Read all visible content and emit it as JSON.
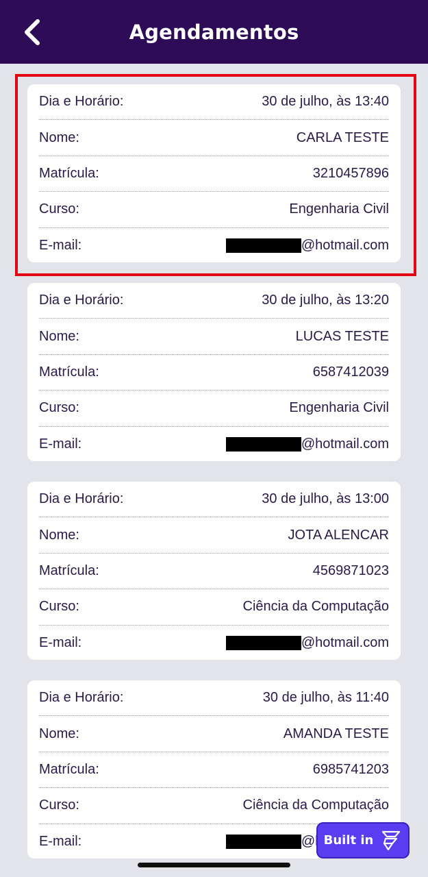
{
  "header": {
    "title": "Agendamentos"
  },
  "icons": {
    "back": "chevron-left-icon",
    "builtin": "flutterflow-logo-icon"
  },
  "labels": {
    "datetime": "Dia e Horário:",
    "name": "Nome:",
    "enrollment": "Matrícula:",
    "course": "Curso:",
    "email": "E-mail:"
  },
  "appointments": [
    {
      "datetime": "30 de julho, às 13:40",
      "name": "CARLA TESTE",
      "enrollment": "3210457896",
      "course": "Engenharia Civil",
      "email": "@hotmail.com"
    },
    {
      "datetime": "30 de julho, às 13:20",
      "name": "LUCAS TESTE",
      "enrollment": "6587412039",
      "course": "Engenharia Civil",
      "email": "@hotmail.com"
    },
    {
      "datetime": "30 de julho, às 13:00",
      "name": "JOTA ALENCAR",
      "enrollment": "4569871023",
      "course": "Ciência da Computação",
      "email": "@hotmail.com"
    },
    {
      "datetime": "30 de julho, às 11:40",
      "name": "AMANDA TESTE",
      "enrollment": "6985741203",
      "course": "Ciência da Computação",
      "email": "@hotmail.com"
    }
  ],
  "badge": {
    "label": "Built in"
  },
  "colors": {
    "header": "#2e0b57",
    "highlight": "#e30613",
    "divider": "#b57fe0",
    "badge": "#5a3df0"
  }
}
